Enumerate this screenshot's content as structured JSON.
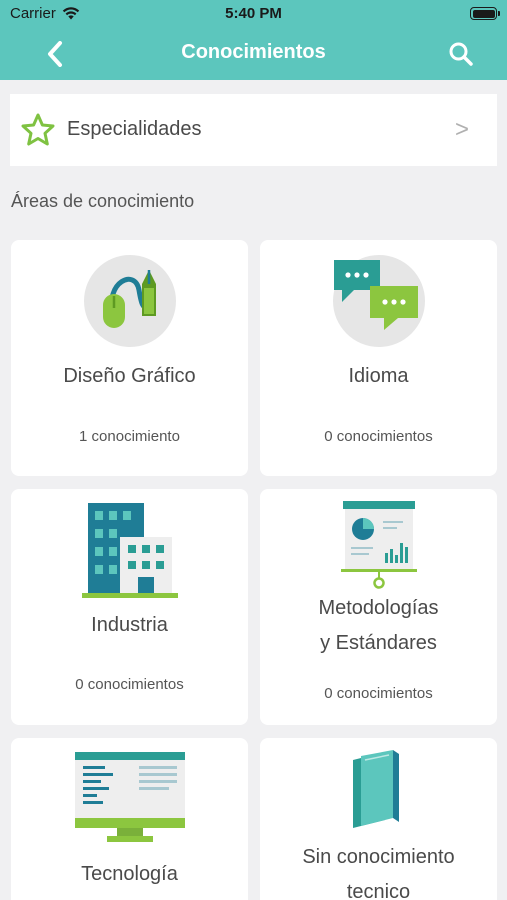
{
  "status_bar": {
    "carrier": "Carrier",
    "time": "5:40 PM"
  },
  "navbar": {
    "title": "Conocimientos",
    "back_icon": "chevron-left-icon",
    "search_icon": "search-icon"
  },
  "specialties": {
    "label": "Especialidades",
    "chevron": ">",
    "icon": "star-icon"
  },
  "section": {
    "title": "Áreas de conocimiento"
  },
  "colors": {
    "accent": "#5cc6bd",
    "green": "#7fc242",
    "background": "#f0f0f2"
  },
  "areas": [
    {
      "name": "Diseño Gráfico",
      "count": "1 conocimiento",
      "icon": "design-mouse-pen-icon"
    },
    {
      "name": "Idioma",
      "count": "0 conocimientos",
      "icon": "speech-bubbles-icon"
    },
    {
      "name": "Industria",
      "count": "0 conocimientos",
      "icon": "buildings-icon"
    },
    {
      "name_line1": "Metodologías",
      "name_line2": "y Estándares",
      "count": "0 conocimientos",
      "icon": "presentation-board-icon"
    },
    {
      "name": "Tecnología",
      "icon": "monitor-code-icon"
    },
    {
      "name_line1": "Sin conocimiento",
      "name_line2": "tecnico",
      "icon": "books-icon"
    }
  ]
}
